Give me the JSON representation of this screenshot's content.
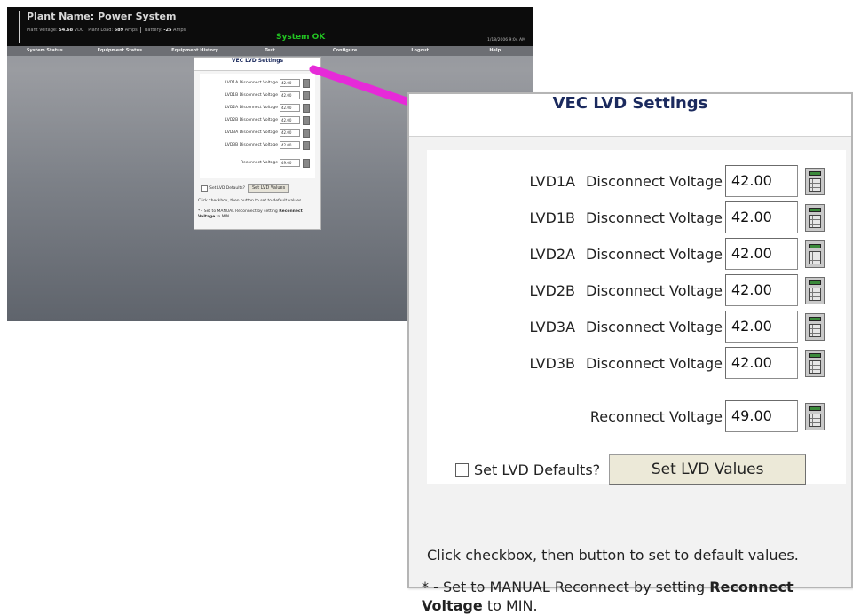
{
  "app": {
    "plant_label": "Plant Name:",
    "plant_name": "Power System",
    "voltage_label": "Plant Voltage:",
    "voltage_value": "54.68",
    "voltage_unit": "VDC",
    "load_label": "Plant Load:",
    "load_value": "689",
    "load_unit": "Amps",
    "battery_label": "Battery:",
    "battery_value": "-25",
    "battery_unit": "Amps",
    "status": "System OK",
    "datetime": "1/18/2006 9:04 AM",
    "nav": [
      "System Status",
      "Equipment Status",
      "Equipment History",
      "Test",
      "Configure",
      "Logout",
      "Help"
    ]
  },
  "panel": {
    "title": "VEC LVD Settings",
    "rows": [
      {
        "name": "LVD1A",
        "label": "Disconnect Voltage",
        "value": "42.00"
      },
      {
        "name": "LVD1B",
        "label": "Disconnect Voltage",
        "value": "42.00"
      },
      {
        "name": "LVD2A",
        "label": "Disconnect Voltage",
        "value": "42.00"
      },
      {
        "name": "LVD2B",
        "label": "Disconnect Voltage",
        "value": "42.00"
      },
      {
        "name": "LVD3A",
        "label": "Disconnect Voltage",
        "value": "42.00"
      },
      {
        "name": "LVD3B",
        "label": "Disconnect Voltage",
        "value": "42.00"
      }
    ],
    "reconnect": {
      "label": "Reconnect Voltage",
      "value": "49.00"
    },
    "defaults_label": "Set LVD Defaults?",
    "defaults_checked": false,
    "button_label": "Set LVD Values",
    "note_click": "Click checkbox, then button to set to default values.",
    "note_manual_prefix": "* - Set to MANUAL Reconnect by setting ",
    "note_manual_bold": "Reconnect Voltage",
    "note_manual_suffix": " to MIN."
  },
  "colors": {
    "title_text": "#1b2a5e",
    "status_ok": "#22c322",
    "arrow": "#e62ad8",
    "button_face": "#ece9d8"
  },
  "icons": {
    "keypad": "keypad-icon",
    "arrow": "arrow-icon"
  }
}
